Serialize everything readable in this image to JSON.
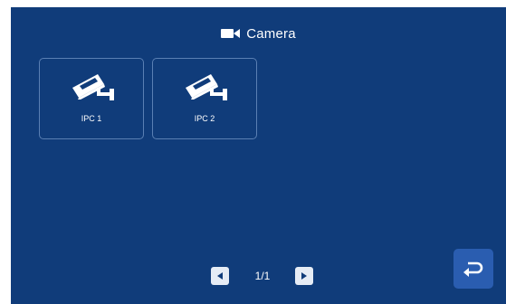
{
  "header": {
    "title": "Camera",
    "icon": "video-camera-icon"
  },
  "cameras": [
    {
      "label": "IPC 1",
      "icon": "cctv-camera-icon"
    },
    {
      "label": "IPC 2",
      "icon": "cctv-camera-icon"
    }
  ],
  "pagination": {
    "text": "1/1",
    "prev_icon": "triangle-left-icon",
    "next_icon": "triangle-right-icon"
  },
  "back": {
    "icon": "return-arrow-icon"
  },
  "colors": {
    "background": "#103c7a",
    "tile_border": "#5a7fb3",
    "back_button": "#2a5db0",
    "text": "#ffffff"
  }
}
